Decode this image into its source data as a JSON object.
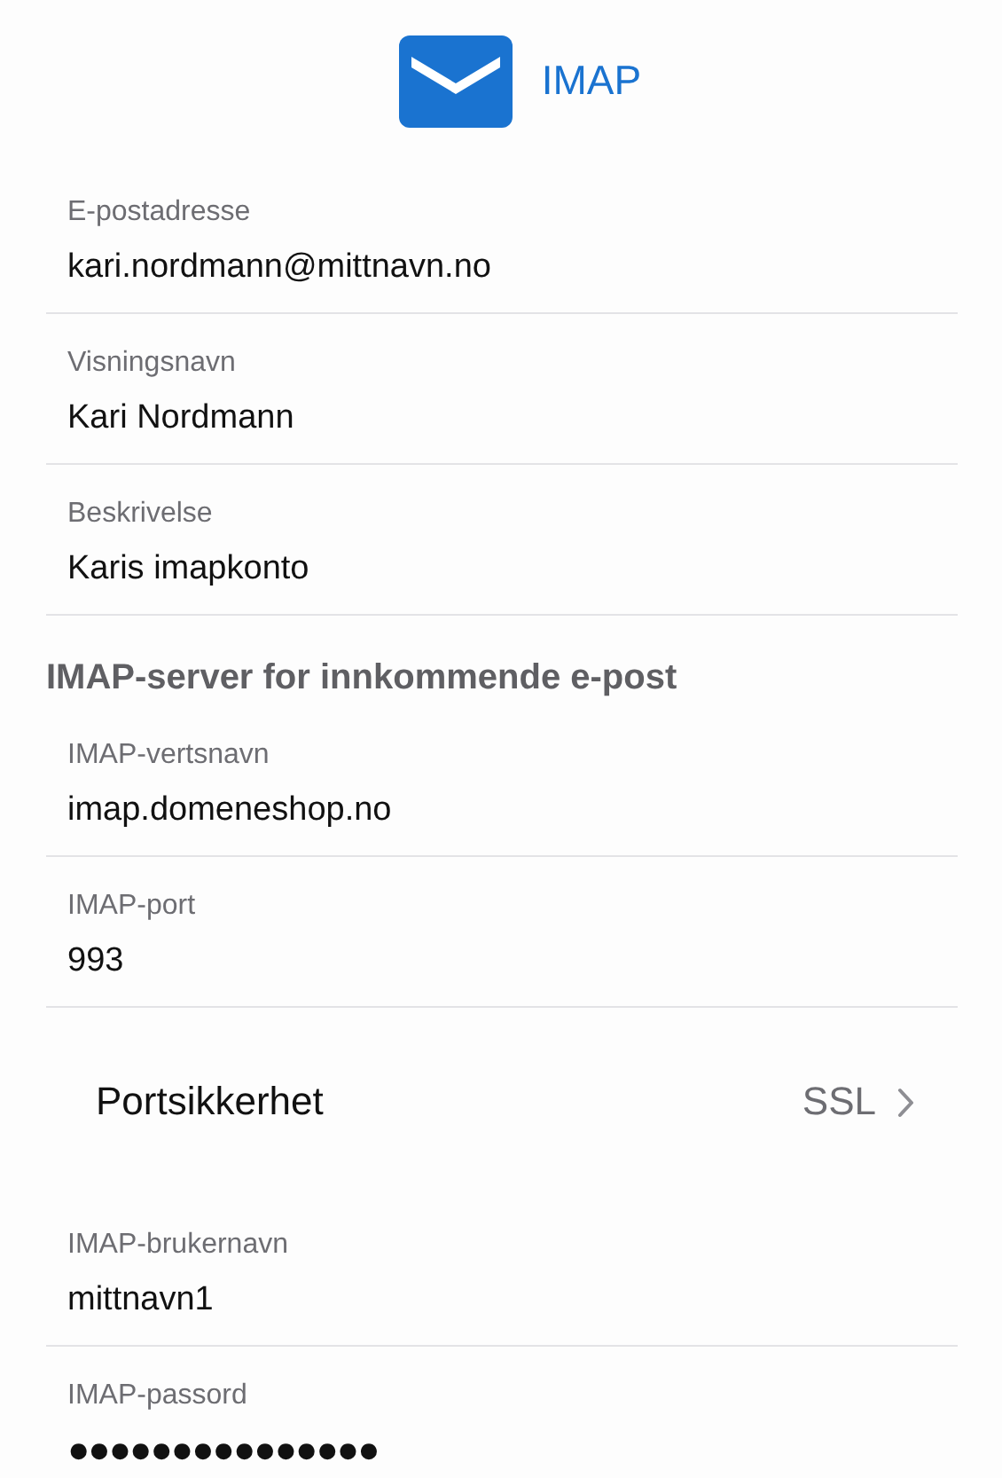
{
  "header": {
    "title": "IMAP"
  },
  "items": [
    {
      "kind": "field",
      "label": "E-postadresse",
      "value": "kari.nordmann@mittnavn.no"
    },
    {
      "kind": "field",
      "label": "Visningsnavn",
      "value": "Kari Nordmann"
    },
    {
      "kind": "field",
      "label": "Beskrivelse",
      "value": "Karis imapkonto"
    },
    {
      "kind": "section",
      "label": "IMAP-server for innkommende e-post"
    },
    {
      "kind": "field",
      "label": "IMAP-vertsnavn",
      "value": "imap.domeneshop.no"
    },
    {
      "kind": "field",
      "label": "IMAP-port",
      "value": "993"
    },
    {
      "kind": "select",
      "label": "Portsikkerhet",
      "value": "SSL"
    },
    {
      "kind": "field",
      "label": "IMAP-brukernavn",
      "value": "mittnavn1"
    },
    {
      "kind": "password",
      "label": "IMAP-passord",
      "value": "●●●●●●●●●●●●●●●"
    }
  ]
}
